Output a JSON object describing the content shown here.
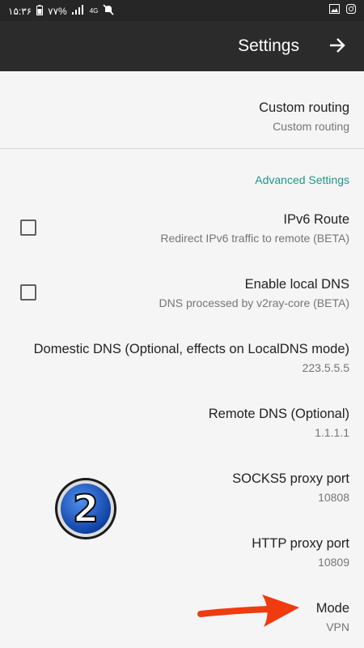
{
  "status_bar": {
    "time": "۱۵:۳۶",
    "battery": "۷۷%",
    "network": "4G"
  },
  "app_bar": {
    "title": "Settings"
  },
  "settings": {
    "custom_routing": {
      "title": "Custom routing",
      "summary": "Custom routing"
    },
    "advanced_category": "Advanced Settings",
    "ipv6_route": {
      "title": "IPv6 Route",
      "summary": "Redirect IPv6 traffic to remote (BETA)",
      "checked": false
    },
    "local_dns": {
      "title": "Enable local DNS",
      "summary": "DNS processed by v2ray-core (BETA)",
      "checked": false
    },
    "domestic_dns": {
      "title": "Domestic DNS (Optional, effects on LocalDNS mode)",
      "summary": "223.5.5.5"
    },
    "remote_dns": {
      "title": "Remote DNS (Optional)",
      "summary": "1.1.1.1"
    },
    "socks_port": {
      "title": "SOCKS5 proxy port",
      "summary": "10808"
    },
    "http_port": {
      "title": "HTTP proxy port",
      "summary": "10809"
    },
    "mode": {
      "title": "Mode",
      "summary": "VPN"
    }
  },
  "overlays": {
    "badge_number": "2",
    "badge_color": "#1565c0",
    "arrow_color": "#f03a10"
  },
  "colors": {
    "accent": "#1b9a8a",
    "appbar": "#2b2b2b",
    "background": "#f5f5f5"
  }
}
